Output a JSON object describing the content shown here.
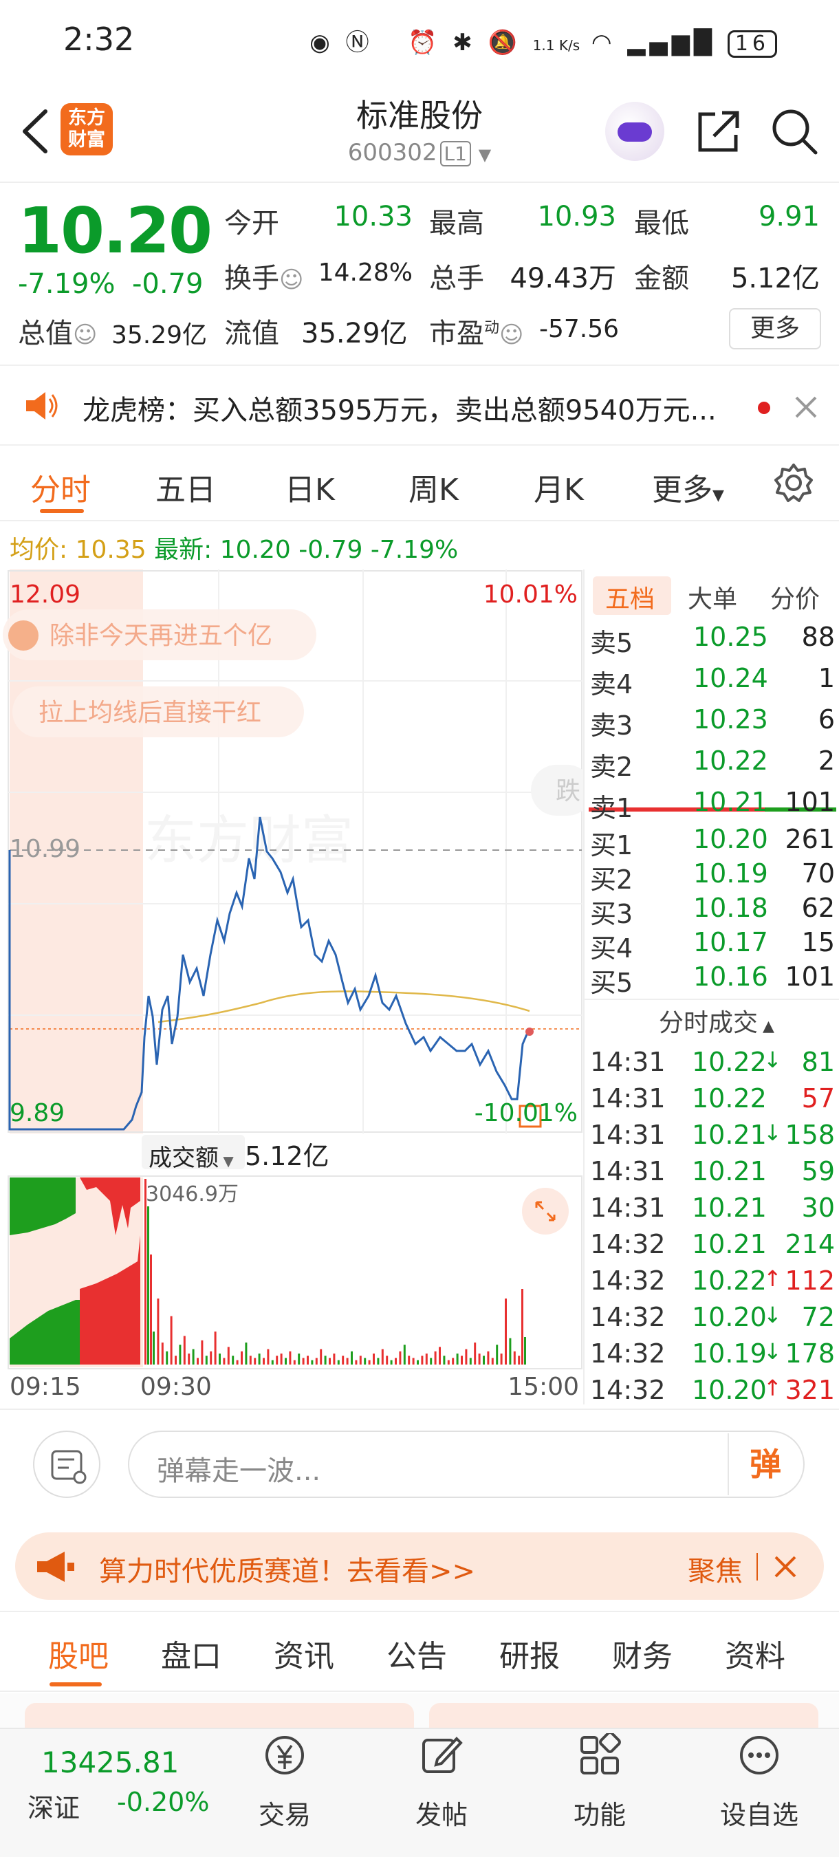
{
  "status_bar": {
    "time": "2:32",
    "net_speed": "1.1 K/s",
    "battery": "16"
  },
  "header": {
    "title": "标准股份",
    "code": "600302",
    "level": "L1",
    "logo_line1": "东方",
    "logo_line2": "财富"
  },
  "quote": {
    "price": "10.20",
    "change_pct": "-7.19%",
    "change_abs": "-0.79",
    "open_label": "今开",
    "open": "10.33",
    "high_label": "最高",
    "high": "10.93",
    "low_label": "最低",
    "low": "9.91",
    "turnover_label": "换手",
    "turnover": "14.28%",
    "volume_label": "总手",
    "volume": "49.43万",
    "amount_label": "金额",
    "amount": "5.12亿",
    "mktcap_label": "总值",
    "mktcap": "35.29亿",
    "float_label": "流值",
    "float": "35.29亿",
    "pe_label": "市盈",
    "pe_sup": "动",
    "pe": "-57.56",
    "more": "更多"
  },
  "notice": {
    "text": "龙虎榜：买入总额3595万元，卖出总额9540万元..."
  },
  "chart_tabs": [
    "分时",
    "五日",
    "日K",
    "周K",
    "月K",
    "更多"
  ],
  "avg_line": {
    "avg_label": "均价:",
    "avg": "10.35",
    "last_label": "最新:",
    "last": "10.20",
    "chg": "-0.79",
    "pct": "-7.19%"
  },
  "chart": {
    "y_top": "12.09",
    "y_bottom": "9.89",
    "pct_top": "10.01%",
    "pct_bottom": "-10.01%",
    "ref_price": "10.99",
    "watermark": "东方财富",
    "danmu_1": "除非今天再进五个亿",
    "danmu_2": "拉上均线后直接干红",
    "danmu_3": "跌",
    "vol_label": "成交额",
    "vol_total": "5.12亿",
    "vol_max": "3046.9万",
    "time_start": "09:15",
    "time_mid": "09:30",
    "time_end": "15:00"
  },
  "levels": {
    "tabs": [
      "五档",
      "大单",
      "分价"
    ],
    "asks": [
      {
        "label": "卖5",
        "price": "10.25",
        "vol": "88"
      },
      {
        "label": "卖4",
        "price": "10.24",
        "vol": "1"
      },
      {
        "label": "卖3",
        "price": "10.23",
        "vol": "6"
      },
      {
        "label": "卖2",
        "price": "10.22",
        "vol": "2"
      },
      {
        "label": "卖1",
        "price": "10.21",
        "vol": "101"
      }
    ],
    "bids": [
      {
        "label": "买1",
        "price": "10.20",
        "vol": "261"
      },
      {
        "label": "买2",
        "price": "10.19",
        "vol": "70"
      },
      {
        "label": "买3",
        "price": "10.18",
        "vol": "62"
      },
      {
        "label": "买4",
        "price": "10.17",
        "vol": "15"
      },
      {
        "label": "买5",
        "price": "10.16",
        "vol": "101"
      }
    ],
    "trades_title": "分时成交",
    "trades": [
      {
        "time": "14:31",
        "price": "10.22",
        "dir": "↓",
        "vol": "81",
        "color": "#0b9b2a"
      },
      {
        "time": "14:31",
        "price": "10.22",
        "dir": "",
        "vol": "57",
        "color": "#e02020"
      },
      {
        "time": "14:31",
        "price": "10.21",
        "dir": "↓",
        "vol": "158",
        "color": "#0b9b2a"
      },
      {
        "time": "14:31",
        "price": "10.21",
        "dir": "",
        "vol": "59",
        "color": "#0b9b2a"
      },
      {
        "time": "14:31",
        "price": "10.21",
        "dir": "",
        "vol": "30",
        "color": "#0b9b2a"
      },
      {
        "time": "14:32",
        "price": "10.21",
        "dir": "",
        "vol": "214",
        "color": "#0b9b2a"
      },
      {
        "time": "14:32",
        "price": "10.22",
        "dir": "↑",
        "vol": "112",
        "color": "#e02020"
      },
      {
        "time": "14:32",
        "price": "10.20",
        "dir": "↓",
        "vol": "72",
        "color": "#0b9b2a"
      },
      {
        "time": "14:32",
        "price": "10.19",
        "dir": "↓",
        "vol": "178",
        "color": "#0b9b2a"
      },
      {
        "time": "14:32",
        "price": "10.20",
        "dir": "↑",
        "vol": "321",
        "color": "#e02020"
      }
    ]
  },
  "barrage": {
    "placeholder": "弹幕走一波...",
    "send": "弹"
  },
  "promo": {
    "text": "算力时代优质赛道！去看看>>",
    "focus": "聚焦"
  },
  "info_tabs": [
    "股吧",
    "盘口",
    "资讯",
    "公告",
    "研报",
    "财务",
    "资料"
  ],
  "bottom_nav": {
    "index_value": "13425.81",
    "index_name": "深证",
    "index_change": "-0.20%",
    "items": [
      "交易",
      "发帖",
      "功能",
      "设自选"
    ]
  },
  "colors": {
    "accent": "#f26b1d",
    "down": "#0b9b2a",
    "up": "#e02020"
  }
}
